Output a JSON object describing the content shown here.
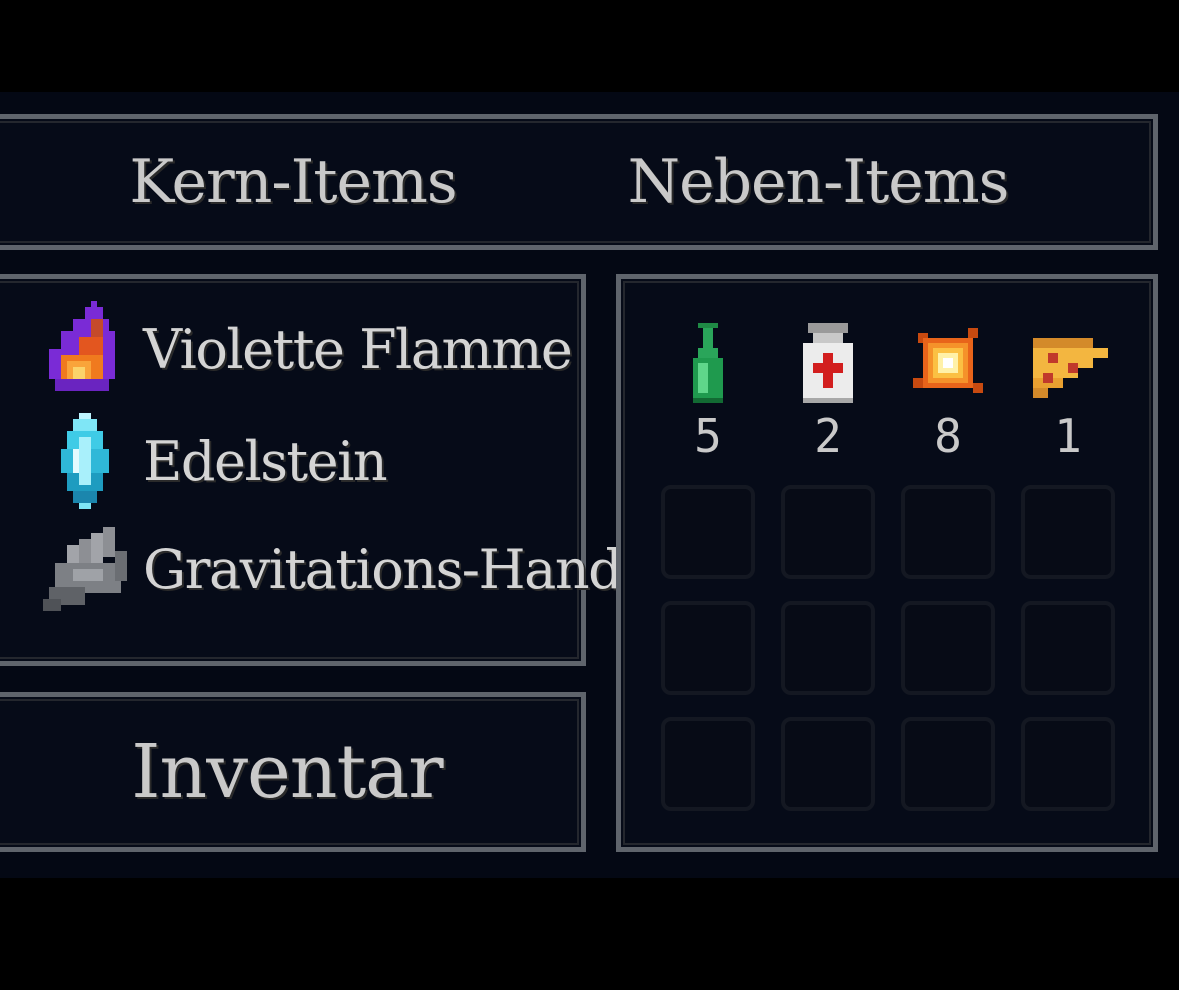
{
  "tabs": {
    "core_label": "Kern-Items",
    "side_label": "Neben-Items"
  },
  "core_items": [
    {
      "label": "Violette Flamme",
      "icon": "violet-flame-icon"
    },
    {
      "label": "Edelstein",
      "icon": "gem-icon"
    },
    {
      "label": "Gravitations-Hand",
      "icon": "gravity-hand-icon"
    }
  ],
  "inventory": {
    "label": "Inventar"
  },
  "side_items": [
    {
      "icon": "green-bottle-icon",
      "count": "5"
    },
    {
      "icon": "medicine-bottle-icon",
      "count": "2"
    },
    {
      "icon": "explosion-icon",
      "count": "8"
    },
    {
      "icon": "pizza-slice-icon",
      "count": "1"
    }
  ],
  "empty_slots": 12,
  "colors": {
    "background": "#000000",
    "panel_fill": "#060b18",
    "panel_border": "#5f646c",
    "text": "#c9c9c9"
  }
}
